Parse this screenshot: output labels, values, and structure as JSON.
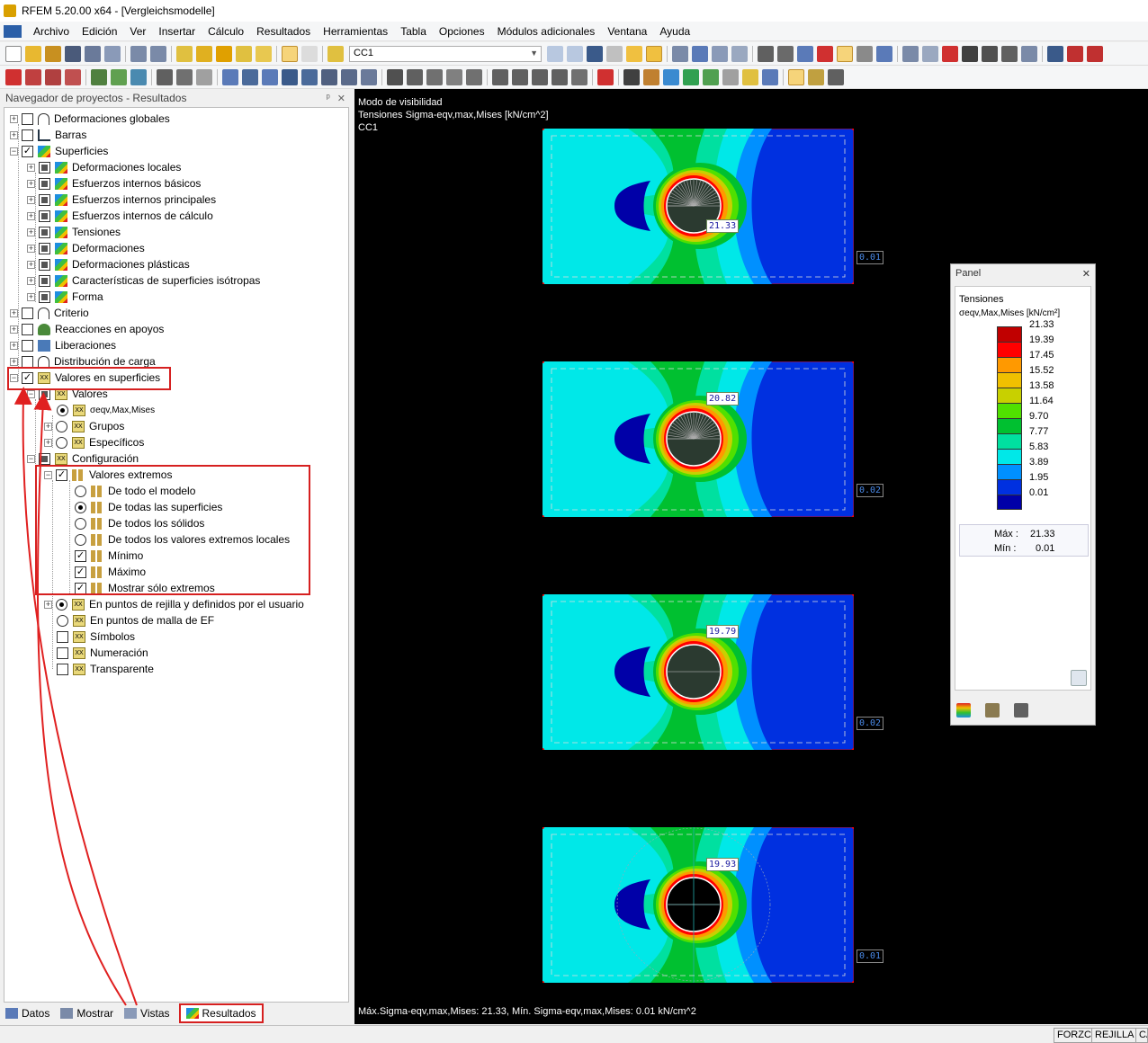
{
  "window": {
    "title": "RFEM 5.20.00 x64 - [Vergleichsmodelle]"
  },
  "menu": [
    "Archivo",
    "Edición",
    "Ver",
    "Insertar",
    "Cálculo",
    "Resultados",
    "Herramientas",
    "Tabla",
    "Opciones",
    "Módulos adicionales",
    "Ventana",
    "Ayuda"
  ],
  "toolbar": {
    "load_case": "CC1"
  },
  "navigator": {
    "title": "Navegador de proyectos - Resultados",
    "items": {
      "deformaciones_globales": "Deformaciones globales",
      "barras": "Barras",
      "superficies": "Superficies",
      "deformaciones_locales": "Deformaciones locales",
      "esfuerzos_basicos": "Esfuerzos internos básicos",
      "esfuerzos_principales": "Esfuerzos internos principales",
      "esfuerzos_calculo": "Esfuerzos internos de cálculo",
      "tensiones": "Tensiones",
      "deformaciones": "Deformaciones",
      "deformaciones_plasticas": "Deformaciones plásticas",
      "caracteristicas": "Características de superficies isótropas",
      "forma": "Forma",
      "criterio": "Criterio",
      "reacciones": "Reacciones en apoyos",
      "liberaciones": "Liberaciones",
      "distribucion": "Distribución de carga",
      "valores_superficies": "Valores en superficies",
      "valores": "Valores",
      "sigma": "σeqv,Max,Mises",
      "grupos": "Grupos",
      "especificos": "Específicos",
      "configuracion": "Configuración",
      "valores_extremos": "Valores extremos",
      "todo_modelo": "De todo el modelo",
      "todas_superficies": "De todas las superficies",
      "todos_solidos": "De todos los sólidos",
      "extremos_locales": "De todos los valores extremos locales",
      "minimo": "Mínimo",
      "maximo": "Máximo",
      "solo_extremos": "Mostrar sólo extremos",
      "puntos_rejilla": "En puntos de rejilla y definidos por el usuario",
      "puntos_malla": "En puntos de malla de EF",
      "simbolos": "Símbolos",
      "numeracion": "Numeración",
      "transparente": "Transparente"
    },
    "tabs": [
      "Datos",
      "Mostrar",
      "Vistas",
      "Resultados"
    ]
  },
  "viewport": {
    "info": [
      "Modo de visibilidad",
      "Tensiones Sigma-eqv,max,Mises [kN/cm^2]",
      "CC1"
    ],
    "bottom": "Máx.Sigma-eqv,max,Mises: 21.33, Mín. Sigma-eqv,max,Mises: 0.01 kN/cm^2",
    "max_labels": [
      "21.33",
      "20.82",
      "19.79",
      "19.93"
    ],
    "min_labels": [
      "0.01",
      "0.02",
      "0.02",
      "0.01"
    ]
  },
  "panel": {
    "title": "Panel",
    "heading": "Tensiones",
    "quantity": "σeqv,Max,Mises [kN/cm²]",
    "legend": [
      {
        "value": "21.33",
        "color": "#c00000"
      },
      {
        "value": "19.39",
        "color": "#ff0000"
      },
      {
        "value": "17.45",
        "color": "#ff9900"
      },
      {
        "value": "15.52",
        "color": "#f0c000"
      },
      {
        "value": "13.58",
        "color": "#c8d000"
      },
      {
        "value": "11.64",
        "color": "#50e000"
      },
      {
        "value": "9.70",
        "color": "#00c030"
      },
      {
        "value": "7.77",
        "color": "#00e0a0"
      },
      {
        "value": "5.83",
        "color": "#00e8e8"
      },
      {
        "value": "3.89",
        "color": "#0090ff"
      },
      {
        "value": "1.95",
        "color": "#0030e0"
      },
      {
        "value": "0.01",
        "color": "#0000a8"
      }
    ],
    "max_label": "Máx  :",
    "max_value": "21.33",
    "min_label": "Mín  :",
    "min_value": "0.01"
  },
  "status": [
    "FORZC",
    "REJILLA",
    "CA"
  ]
}
